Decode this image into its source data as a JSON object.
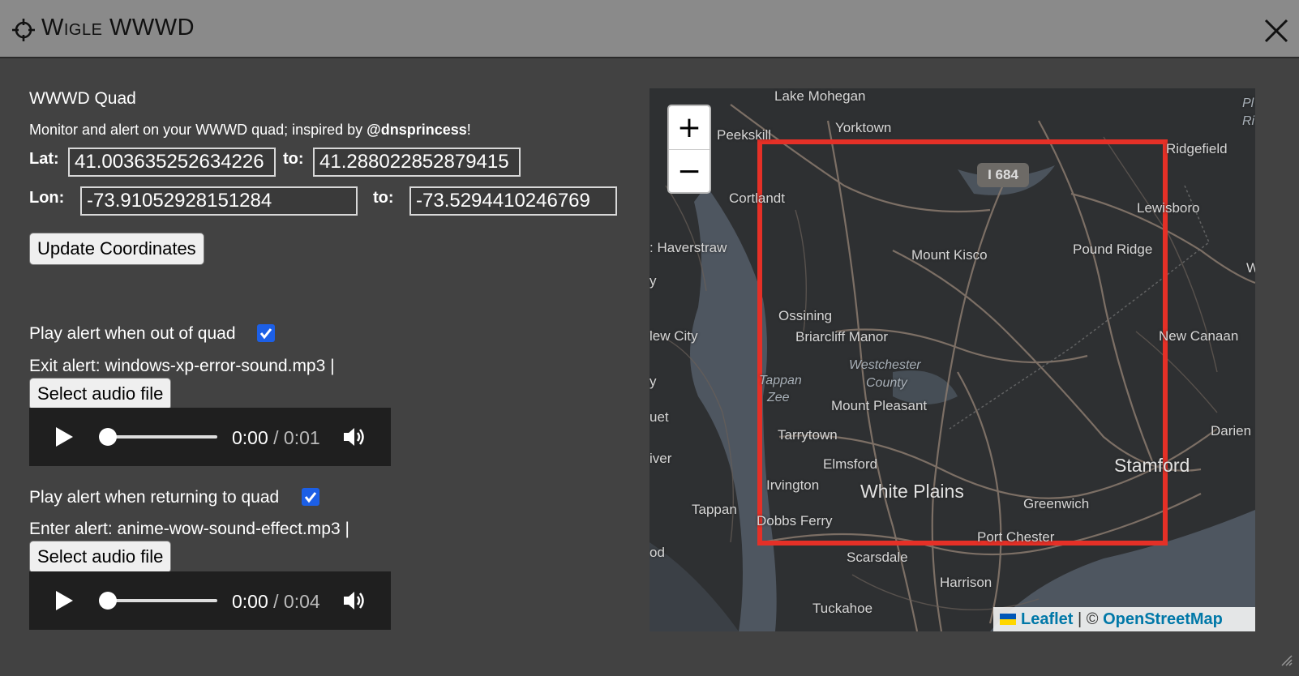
{
  "window": {
    "title": "Wigle WWWD",
    "icon": "crosshair-icon",
    "close_icon": "close-icon"
  },
  "quad": {
    "heading": "WWWD Quad",
    "description_prefix": "Monitor and alert on your WWWD quad; inspired by ",
    "description_handle": "@dnsprincess",
    "description_suffix": "!",
    "lat_label": "Lat:",
    "lat_from": "41.003635252634226",
    "lat_to_label": "to:",
    "lat_to": "41.288022852879415",
    "lon_label": "Lon:",
    "lon_from": "-73.91052928151284",
    "lon_to_label": "to:",
    "lon_to": "-73.5294410246769",
    "update_button": "Update Coordinates"
  },
  "exit_alert": {
    "toggle_label": "Play alert when out of quad",
    "checked": true,
    "file_text": "Exit alert: windows-xp-error-sound.mp3 |",
    "select_button": "Select audio file",
    "current_time": "0:00",
    "duration": "/ 0:01"
  },
  "enter_alert": {
    "toggle_label": "Play alert when returning to quad",
    "checked": true,
    "file_text": "Enter alert: anime-wow-sound-effect.mp3 |",
    "select_button": "Select audio file",
    "current_time": "0:00",
    "duration": "/ 0:04"
  },
  "map": {
    "zoom_in": "+",
    "zoom_out": "−",
    "highway_shield": "I 684",
    "places": {
      "lake_mohegan": "Lake Mohegan",
      "peekskill": "Peekskill",
      "yorktown": "Yorktown",
      "ridgefield": "Ridgefield",
      "cortlandt": "Cortlandt",
      "lewisboro": "Lewisboro",
      "haverstraw": ": Haverstraw",
      "mount_kisco": "Mount Kisco",
      "pound_ridge": "Pound Ridge",
      "ossining": "Ossining",
      "new_city": "lew City",
      "briarcliff": "Briarcliff Manor",
      "new_canaan": "New Canaan",
      "westchester": "Westchester",
      "county": "County",
      "tappan_zee_1": "Tappan",
      "tappan_zee_2": "Zee",
      "mount_pleasant": "Mount Pleasant",
      "tarrytown": "Tarrytown",
      "darien": "Darien",
      "elmsford": "Elmsford",
      "stamford": "Stamford",
      "irvington": "Irvington",
      "white_plains": "White Plains",
      "greenwich": "Greenwich",
      "tappan": "Tappan",
      "dobbs_ferry": "Dobbs Ferry",
      "port_chester": "Port Chester",
      "scarsdale": "Scarsdale",
      "harrison": "Harrison",
      "tuckahoe": "Tuckahoe",
      "edge_w": "W",
      "edge_y": "y",
      "edge_y2": "y",
      "edge_uet": "uet",
      "edge_iver": "iver",
      "edge_od": "od",
      "edge_pl": "Pl",
      "edge_ri": "Ri"
    },
    "attribution_leaflet": "Leaflet",
    "attribution_sep": " | © ",
    "attribution_osm": "OpenStreetMap"
  },
  "colors": {
    "quad_border": "#e53027",
    "checkbox": "#1c5fe6",
    "link": "#0078a8"
  }
}
